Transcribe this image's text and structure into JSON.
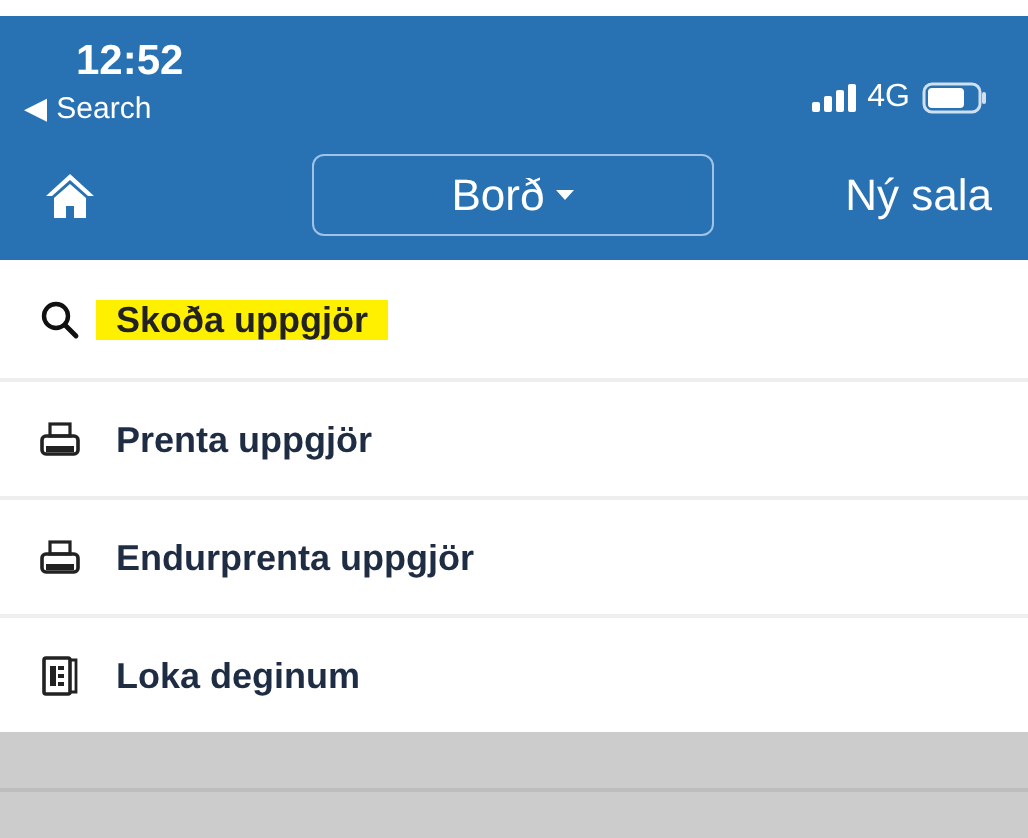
{
  "status_bar": {
    "time": "12:52",
    "back_label": "◀ Search",
    "network": "4G",
    "battery": {
      "level": 0.75
    }
  },
  "nav_bar": {
    "title": "Borð",
    "right_action": "Ný sala"
  },
  "menu": [
    {
      "label": "Skoða uppgjör",
      "kind": "search",
      "highlighted": true
    },
    {
      "label": "Prenta uppgjör",
      "kind": "print",
      "highlighted": false
    },
    {
      "label": "Endurprenta uppgjör",
      "kind": "print",
      "highlighted": false
    },
    {
      "label": "Loka deginum",
      "kind": "receipt",
      "highlighted": false
    }
  ]
}
